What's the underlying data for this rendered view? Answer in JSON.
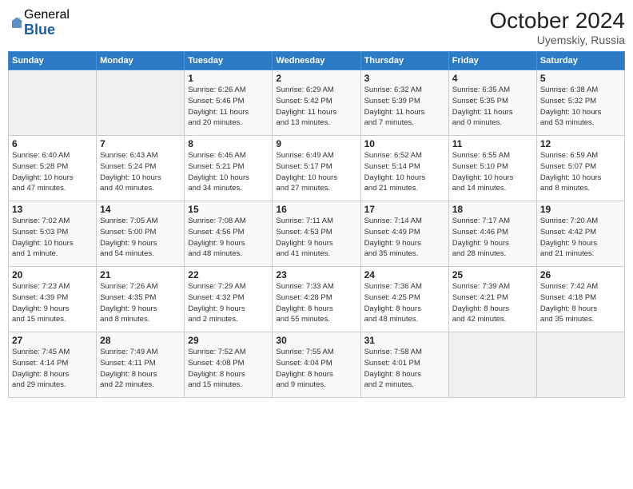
{
  "logo": {
    "general": "General",
    "blue": "Blue"
  },
  "header": {
    "month_year": "October 2024",
    "location": "Uyemskiy, Russia"
  },
  "weekdays": [
    "Sunday",
    "Monday",
    "Tuesday",
    "Wednesday",
    "Thursday",
    "Friday",
    "Saturday"
  ],
  "weeks": [
    [
      {
        "day": "",
        "info": ""
      },
      {
        "day": "",
        "info": ""
      },
      {
        "day": "1",
        "info": "Sunrise: 6:26 AM\nSunset: 5:46 PM\nDaylight: 11 hours\nand 20 minutes."
      },
      {
        "day": "2",
        "info": "Sunrise: 6:29 AM\nSunset: 5:42 PM\nDaylight: 11 hours\nand 13 minutes."
      },
      {
        "day": "3",
        "info": "Sunrise: 6:32 AM\nSunset: 5:39 PM\nDaylight: 11 hours\nand 7 minutes."
      },
      {
        "day": "4",
        "info": "Sunrise: 6:35 AM\nSunset: 5:35 PM\nDaylight: 11 hours\nand 0 minutes."
      },
      {
        "day": "5",
        "info": "Sunrise: 6:38 AM\nSunset: 5:32 PM\nDaylight: 10 hours\nand 53 minutes."
      }
    ],
    [
      {
        "day": "6",
        "info": "Sunrise: 6:40 AM\nSunset: 5:28 PM\nDaylight: 10 hours\nand 47 minutes."
      },
      {
        "day": "7",
        "info": "Sunrise: 6:43 AM\nSunset: 5:24 PM\nDaylight: 10 hours\nand 40 minutes."
      },
      {
        "day": "8",
        "info": "Sunrise: 6:46 AM\nSunset: 5:21 PM\nDaylight: 10 hours\nand 34 minutes."
      },
      {
        "day": "9",
        "info": "Sunrise: 6:49 AM\nSunset: 5:17 PM\nDaylight: 10 hours\nand 27 minutes."
      },
      {
        "day": "10",
        "info": "Sunrise: 6:52 AM\nSunset: 5:14 PM\nDaylight: 10 hours\nand 21 minutes."
      },
      {
        "day": "11",
        "info": "Sunrise: 6:55 AM\nSunset: 5:10 PM\nDaylight: 10 hours\nand 14 minutes."
      },
      {
        "day": "12",
        "info": "Sunrise: 6:59 AM\nSunset: 5:07 PM\nDaylight: 10 hours\nand 8 minutes."
      }
    ],
    [
      {
        "day": "13",
        "info": "Sunrise: 7:02 AM\nSunset: 5:03 PM\nDaylight: 10 hours\nand 1 minute."
      },
      {
        "day": "14",
        "info": "Sunrise: 7:05 AM\nSunset: 5:00 PM\nDaylight: 9 hours\nand 54 minutes."
      },
      {
        "day": "15",
        "info": "Sunrise: 7:08 AM\nSunset: 4:56 PM\nDaylight: 9 hours\nand 48 minutes."
      },
      {
        "day": "16",
        "info": "Sunrise: 7:11 AM\nSunset: 4:53 PM\nDaylight: 9 hours\nand 41 minutes."
      },
      {
        "day": "17",
        "info": "Sunrise: 7:14 AM\nSunset: 4:49 PM\nDaylight: 9 hours\nand 35 minutes."
      },
      {
        "day": "18",
        "info": "Sunrise: 7:17 AM\nSunset: 4:46 PM\nDaylight: 9 hours\nand 28 minutes."
      },
      {
        "day": "19",
        "info": "Sunrise: 7:20 AM\nSunset: 4:42 PM\nDaylight: 9 hours\nand 21 minutes."
      }
    ],
    [
      {
        "day": "20",
        "info": "Sunrise: 7:23 AM\nSunset: 4:39 PM\nDaylight: 9 hours\nand 15 minutes."
      },
      {
        "day": "21",
        "info": "Sunrise: 7:26 AM\nSunset: 4:35 PM\nDaylight: 9 hours\nand 8 minutes."
      },
      {
        "day": "22",
        "info": "Sunrise: 7:29 AM\nSunset: 4:32 PM\nDaylight: 9 hours\nand 2 minutes."
      },
      {
        "day": "23",
        "info": "Sunrise: 7:33 AM\nSunset: 4:28 PM\nDaylight: 8 hours\nand 55 minutes."
      },
      {
        "day": "24",
        "info": "Sunrise: 7:36 AM\nSunset: 4:25 PM\nDaylight: 8 hours\nand 48 minutes."
      },
      {
        "day": "25",
        "info": "Sunrise: 7:39 AM\nSunset: 4:21 PM\nDaylight: 8 hours\nand 42 minutes."
      },
      {
        "day": "26",
        "info": "Sunrise: 7:42 AM\nSunset: 4:18 PM\nDaylight: 8 hours\nand 35 minutes."
      }
    ],
    [
      {
        "day": "27",
        "info": "Sunrise: 7:45 AM\nSunset: 4:14 PM\nDaylight: 8 hours\nand 29 minutes."
      },
      {
        "day": "28",
        "info": "Sunrise: 7:49 AM\nSunset: 4:11 PM\nDaylight: 8 hours\nand 22 minutes."
      },
      {
        "day": "29",
        "info": "Sunrise: 7:52 AM\nSunset: 4:08 PM\nDaylight: 8 hours\nand 15 minutes."
      },
      {
        "day": "30",
        "info": "Sunrise: 7:55 AM\nSunset: 4:04 PM\nDaylight: 8 hours\nand 9 minutes."
      },
      {
        "day": "31",
        "info": "Sunrise: 7:58 AM\nSunset: 4:01 PM\nDaylight: 8 hours\nand 2 minutes."
      },
      {
        "day": "",
        "info": ""
      },
      {
        "day": "",
        "info": ""
      }
    ]
  ]
}
